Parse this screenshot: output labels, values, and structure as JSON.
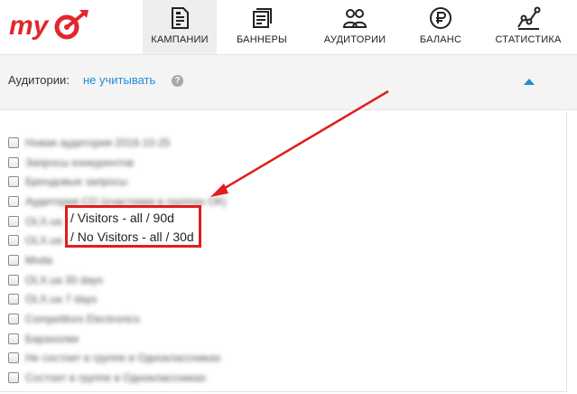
{
  "logo": {
    "text": "my"
  },
  "nav": {
    "items": [
      {
        "label": "КАМПАНИИ",
        "icon": "campaigns-document-icon",
        "active": true
      },
      {
        "label": "БАННЕРЫ",
        "icon": "banners-icon",
        "active": false
      },
      {
        "label": "АУДИТОРИИ",
        "icon": "audiences-people-icon",
        "active": false
      },
      {
        "label": "БАЛАНС",
        "icon": "ruble-coin-icon",
        "active": false
      },
      {
        "label": "СТАТИСТИКА",
        "icon": "statistics-chart-icon",
        "active": false
      }
    ]
  },
  "audiences": {
    "label": "Аудитории:",
    "value": "не учитывать",
    "help": "?",
    "items": [
      "Новая аудитория 2016-10-25",
      "Запросы конкурентов",
      "Брендовые запросы",
      "Аудитория СО (участники в группах ОК)",
      "OLX.ua",
      "OLX.ua",
      "Moda",
      "OLX.ua 30 days",
      "OLX.ua 7 days",
      "Competitors Electronics",
      "Барахолки",
      "Не состоит в группе в Одноклассниках",
      "Состоит в группе в Одноклассниках"
    ]
  },
  "annotation": {
    "line1": "/ Visitors - all / 90d",
    "line2": "/ No Visitors - all / 30d"
  },
  "colors": {
    "accent": "#1f8dd6",
    "brand": "#e3262c",
    "annotation": "#e11d1d"
  }
}
